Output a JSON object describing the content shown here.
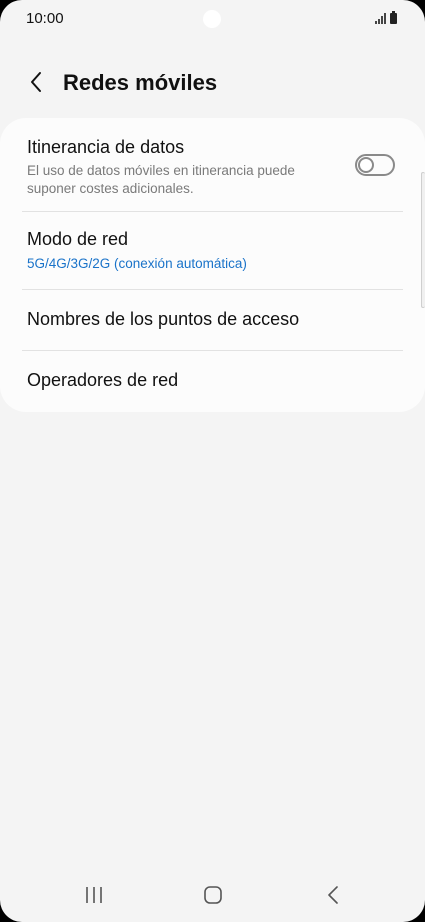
{
  "status_bar": {
    "time": "10:00"
  },
  "header": {
    "title": "Redes móviles",
    "back_icon": "chevron-left-icon"
  },
  "settings": {
    "roaming": {
      "title": "Itinerancia de datos",
      "description": "El uso de datos móviles en itinerancia puede suponer costes adicionales.",
      "toggle_on": false
    },
    "network_mode": {
      "title": "Modo de red",
      "value": "5G/4G/3G/2G (conexión automática)"
    },
    "apn": {
      "title": "Nombres de los puntos de acceso"
    },
    "operators": {
      "title": "Operadores de red"
    }
  },
  "nav_bar": {
    "items": [
      "recent-apps-icon",
      "home-icon",
      "back-icon"
    ]
  },
  "colors": {
    "background": "#f4f4f4",
    "card": "#fcfcfc",
    "accent": "#1a73c9"
  }
}
